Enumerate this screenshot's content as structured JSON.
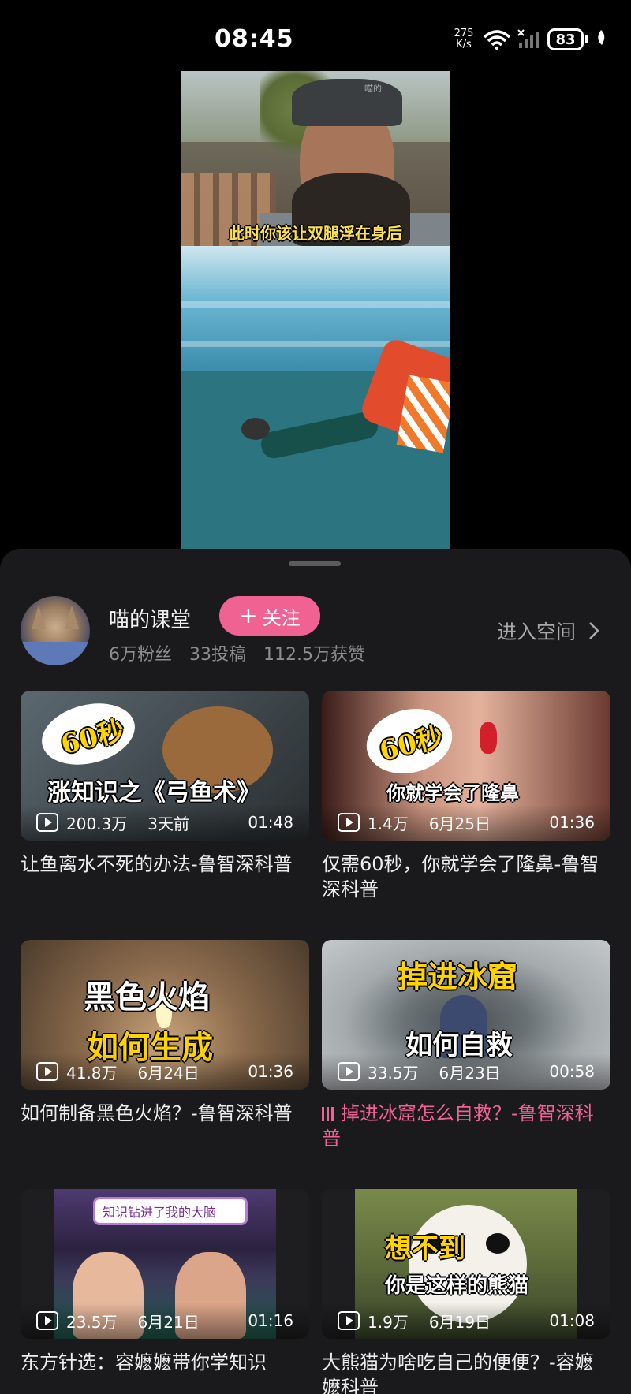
{
  "status_bar": {
    "time": "08:45",
    "net_speed_value": "275",
    "net_speed_unit": "K/s",
    "battery": "83",
    "icons": [
      "wifi-icon",
      "signal-icon",
      "battery-icon",
      "leaf-icon"
    ]
  },
  "video": {
    "caption": "此时你该让双腿浮在身后",
    "watermark": "喵的"
  },
  "channel": {
    "name": "喵的课堂",
    "follow_label": "关注",
    "followers": "6万粉丝",
    "posts": "33投稿",
    "likes": "112.5万获赞",
    "enter_space_label": "进入空间"
  },
  "videos": [
    {
      "thumb_line1": "60秒",
      "thumb_line2": "涨知识之《弓鱼术》",
      "views": "200.3万",
      "date": "3天前",
      "duration": "01:48",
      "title": "让鱼离水不死的办法-鲁智深科普",
      "playing": false
    },
    {
      "thumb_line1": "60秒",
      "thumb_line2": "你就学会了隆鼻",
      "views": "1.4万",
      "date": "6月25日",
      "duration": "01:36",
      "title": "仅需60秒，你就学会了隆鼻-鲁智深科普",
      "playing": false
    },
    {
      "thumb_line1": "黑色火焰",
      "thumb_line2": "如何生成",
      "views": "41.8万",
      "date": "6月24日",
      "duration": "01:36",
      "title": "如何制备黑色火焰？-鲁智深科普",
      "playing": false
    },
    {
      "thumb_line1": "掉进冰窟",
      "thumb_line2": "如何自救",
      "views": "33.5万",
      "date": "6月23日",
      "duration": "00:58",
      "title": "掉进冰窟怎么自救？-鲁智深科普",
      "playing": true
    },
    {
      "thumb_line1": "知识钻进了我的大脑",
      "thumb_line2": "",
      "views": "23.5万",
      "date": "6月21日",
      "duration": "01:16",
      "title": "东方针选：容嬷嬷带你学知识",
      "playing": false
    },
    {
      "thumb_line1": "想不到",
      "thumb_line2": "你是这样的熊猫",
      "views": "1.9万",
      "date": "6月19日",
      "duration": "01:08",
      "title": "大熊猫为啥吃自己的便便？-容嬷嬷科普",
      "playing": false
    }
  ]
}
